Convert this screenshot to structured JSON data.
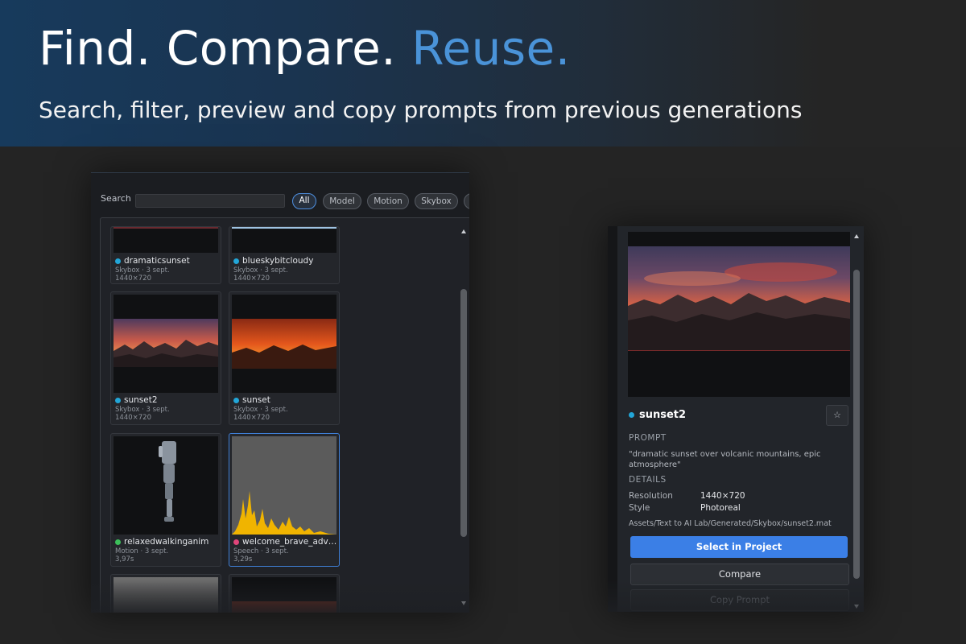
{
  "hero": {
    "title_main": "Find. Compare.",
    "title_accent": "Reuse.",
    "subtitle": "Search, filter, preview and copy prompts from previous generations"
  },
  "browser": {
    "search_label": "Search",
    "search_value": "",
    "filters": [
      {
        "label": "All",
        "active": true
      },
      {
        "label": "Model",
        "active": false
      },
      {
        "label": "Motion",
        "active": false
      },
      {
        "label": "Skybox",
        "active": false
      }
    ],
    "cards": [
      {
        "name": "dramaticsunset",
        "meta": "Skybox · 3 sept.",
        "info": "1440×720",
        "dot_color": "#22a6d8"
      },
      {
        "name": "blueskybitcloudy",
        "meta": "Skybox · 3 sept.",
        "info": "1440×720",
        "dot_color": "#22a6d8"
      },
      {
        "name": "sunset2",
        "meta": "Skybox · 3 sept.",
        "info": "1440×720",
        "dot_color": "#22a6d8"
      },
      {
        "name": "sunset",
        "meta": "Skybox · 3 sept.",
        "info": "1440×720",
        "dot_color": "#22a6d8"
      },
      {
        "name": "relaxedwalkinganim",
        "meta": "Motion · 3 sept.",
        "info": "3,97s",
        "dot_color": "#3cbf5a"
      },
      {
        "name": "welcome_brave_adventurer",
        "meta": "Speech · 3 sept.",
        "info": "3,29s",
        "dot_color": "#e0457a"
      }
    ]
  },
  "detail": {
    "title": "sunset2",
    "dot_color": "#22a6d8",
    "star_icon": "star-icon",
    "prompt_label": "PROMPT",
    "prompt_text": "\"dramatic sunset over volcanic mountains, epic atmosphere\"",
    "details_label": "DETAILS",
    "resolution_key": "Resolution",
    "resolution_val": "1440×720",
    "style_key": "Style",
    "style_val": "Photoreal",
    "path": "Assets/Text to AI Lab/Generated/Skybox/sunset2.mat",
    "select_label": "Select in Project",
    "compare_label": "Compare",
    "copy_label": "Copy Prompt"
  }
}
